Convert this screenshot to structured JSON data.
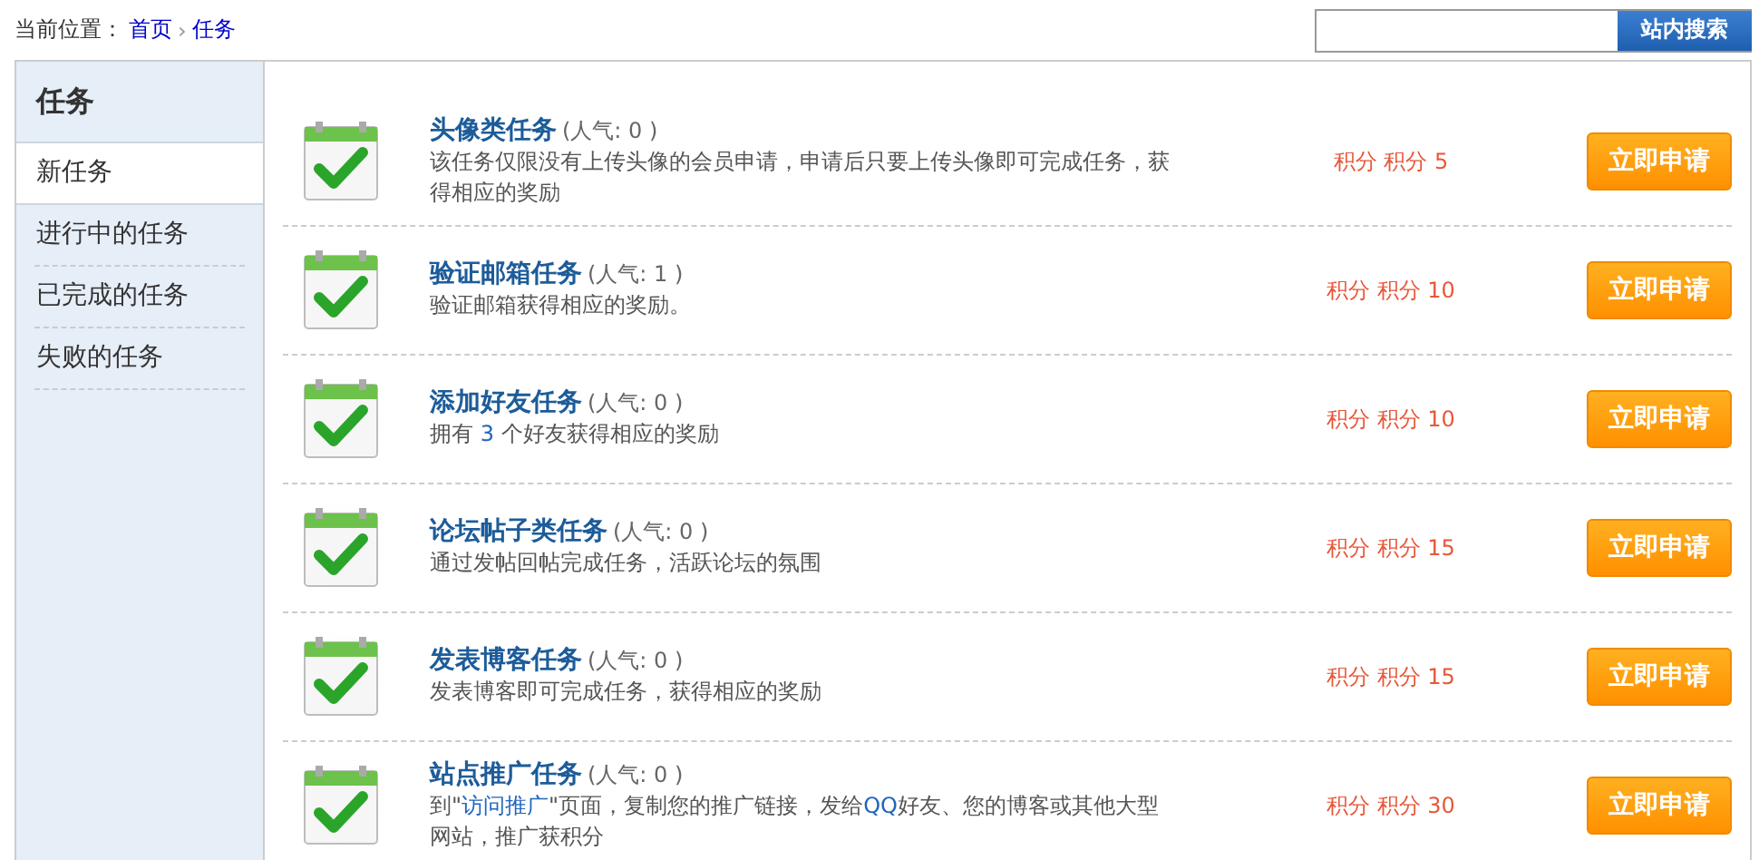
{
  "breadcrumb": {
    "label": "当前位置：",
    "links": [
      "首页",
      "任务"
    ],
    "separator": "›"
  },
  "search": {
    "button": "站内搜索"
  },
  "sidebar": {
    "title": "任务",
    "items": [
      {
        "label": "新任务",
        "selected": true
      },
      {
        "label": "进行中的任务",
        "selected": false
      },
      {
        "label": "已完成的任务",
        "selected": false
      },
      {
        "label": "失败的任务",
        "selected": false
      }
    ]
  },
  "tasks": [
    {
      "title": "头像类任务",
      "popularity": "(人气: 0 )",
      "description": [
        {
          "text": "该任务仅限没有上传头像的会员申请，申请后只要上传头像即可完成任务，获得相应的奖励",
          "highlight": false
        }
      ],
      "points": "积分 积分 5",
      "button": "立即申请"
    },
    {
      "title": "验证邮箱任务",
      "popularity": "(人气: 1 )",
      "description": [
        {
          "text": "验证邮箱获得相应的奖励。",
          "highlight": false
        }
      ],
      "points": "积分 积分 10",
      "button": "立即申请"
    },
    {
      "title": "添加好友任务",
      "popularity": "(人气: 0 )",
      "description": [
        {
          "text": "拥有 ",
          "highlight": false
        },
        {
          "text": "3",
          "highlight": true
        },
        {
          "text": " 个好友获得相应的奖励",
          "highlight": false
        }
      ],
      "points": "积分 积分 10",
      "button": "立即申请"
    },
    {
      "title": "论坛帖子类任务",
      "popularity": "(人气: 0 )",
      "description": [
        {
          "text": "通过发帖回帖完成任务，活跃论坛的氛围",
          "highlight": false
        }
      ],
      "points": "积分 积分 15",
      "button": "立即申请"
    },
    {
      "title": "发表博客任务",
      "popularity": "(人气: 0 )",
      "description": [
        {
          "text": "发表博客即可完成任务，获得相应的奖励",
          "highlight": false
        }
      ],
      "points": "积分 积分 15",
      "button": "立即申请"
    },
    {
      "title": "站点推广任务",
      "popularity": "(人气: 0 )",
      "description": [
        {
          "text": "到\"",
          "highlight": false
        },
        {
          "text": "访问推广",
          "highlight": true
        },
        {
          "text": "\"页面，复制您的推广链接，发给",
          "highlight": false
        },
        {
          "text": "QQ",
          "highlight": true
        },
        {
          "text": "好友、您的博客或其他大型网站，推广获积分",
          "highlight": false
        }
      ],
      "points": "积分 积分 30",
      "button": "立即申请"
    }
  ]
}
